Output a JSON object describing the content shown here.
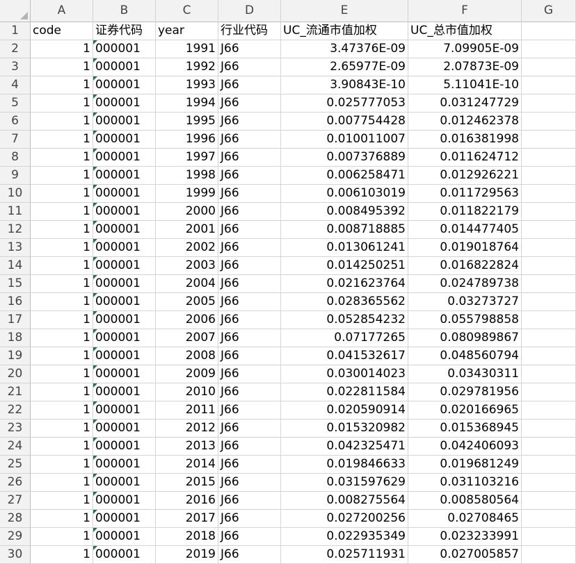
{
  "columns": [
    "A",
    "B",
    "C",
    "D",
    "E",
    "F",
    "G"
  ],
  "row_numbers": [
    "1",
    "2",
    "3",
    "4",
    "5",
    "6",
    "7",
    "8",
    "9",
    "10",
    "11",
    "12",
    "13",
    "14",
    "15",
    "16",
    "17",
    "18",
    "19",
    "20",
    "21",
    "22",
    "23",
    "24",
    "25",
    "26",
    "27",
    "28",
    "29",
    "30"
  ],
  "header_row": [
    "code",
    "证券代码",
    "year",
    "行业代码",
    "UC_流通市值加权",
    "UC_总市值加权"
  ],
  "rows": [
    [
      "1",
      "000001",
      "1991",
      "J66",
      "3.47376E-09",
      "7.09905E-09"
    ],
    [
      "1",
      "000001",
      "1992",
      "J66",
      "2.65977E-09",
      "2.07873E-09"
    ],
    [
      "1",
      "000001",
      "1993",
      "J66",
      "3.90843E-10",
      "5.11041E-10"
    ],
    [
      "1",
      "000001",
      "1994",
      "J66",
      "0.025777053",
      "0.031247729"
    ],
    [
      "1",
      "000001",
      "1995",
      "J66",
      "0.007754428",
      "0.012462378"
    ],
    [
      "1",
      "000001",
      "1996",
      "J66",
      "0.010011007",
      "0.016381998"
    ],
    [
      "1",
      "000001",
      "1997",
      "J66",
      "0.007376889",
      "0.011624712"
    ],
    [
      "1",
      "000001",
      "1998",
      "J66",
      "0.006258471",
      "0.012926221"
    ],
    [
      "1",
      "000001",
      "1999",
      "J66",
      "0.006103019",
      "0.011729563"
    ],
    [
      "1",
      "000001",
      "2000",
      "J66",
      "0.008495392",
      "0.011822179"
    ],
    [
      "1",
      "000001",
      "2001",
      "J66",
      "0.008718885",
      "0.014477405"
    ],
    [
      "1",
      "000001",
      "2002",
      "J66",
      "0.013061241",
      "0.019018764"
    ],
    [
      "1",
      "000001",
      "2003",
      "J66",
      "0.014250251",
      "0.016822824"
    ],
    [
      "1",
      "000001",
      "2004",
      "J66",
      "0.021623764",
      "0.024789738"
    ],
    [
      "1",
      "000001",
      "2005",
      "J66",
      "0.028365562",
      "0.03273727"
    ],
    [
      "1",
      "000001",
      "2006",
      "J66",
      "0.052854232",
      "0.055798858"
    ],
    [
      "1",
      "000001",
      "2007",
      "J66",
      "0.07177265",
      "0.080989867"
    ],
    [
      "1",
      "000001",
      "2008",
      "J66",
      "0.041532617",
      "0.048560794"
    ],
    [
      "1",
      "000001",
      "2009",
      "J66",
      "0.030014023",
      "0.03430311"
    ],
    [
      "1",
      "000001",
      "2010",
      "J66",
      "0.022811584",
      "0.029781956"
    ],
    [
      "1",
      "000001",
      "2011",
      "J66",
      "0.020590914",
      "0.020166965"
    ],
    [
      "1",
      "000001",
      "2012",
      "J66",
      "0.015320982",
      "0.015368945"
    ],
    [
      "1",
      "000001",
      "2013",
      "J66",
      "0.042325471",
      "0.042406093"
    ],
    [
      "1",
      "000001",
      "2014",
      "J66",
      "0.019846633",
      "0.019681249"
    ],
    [
      "1",
      "000001",
      "2015",
      "J66",
      "0.031597629",
      "0.031103216"
    ],
    [
      "1",
      "000001",
      "2016",
      "J66",
      "0.008275564",
      "0.008580564"
    ],
    [
      "1",
      "000001",
      "2017",
      "J66",
      "0.027200256",
      "0.02708465"
    ],
    [
      "1",
      "000001",
      "2018",
      "J66",
      "0.022935349",
      "0.023233991"
    ],
    [
      "1",
      "000001",
      "2019",
      "J66",
      "0.025711931",
      "0.027005857"
    ]
  ],
  "colors": {
    "header_bg": "#f2f2f2",
    "gridline": "#d4d4d4",
    "text_flag": "#1d7a3a"
  },
  "icons": {
    "corner": "select-all-triangle-icon",
    "cell_flag": "number-stored-as-text-flag-icon"
  }
}
